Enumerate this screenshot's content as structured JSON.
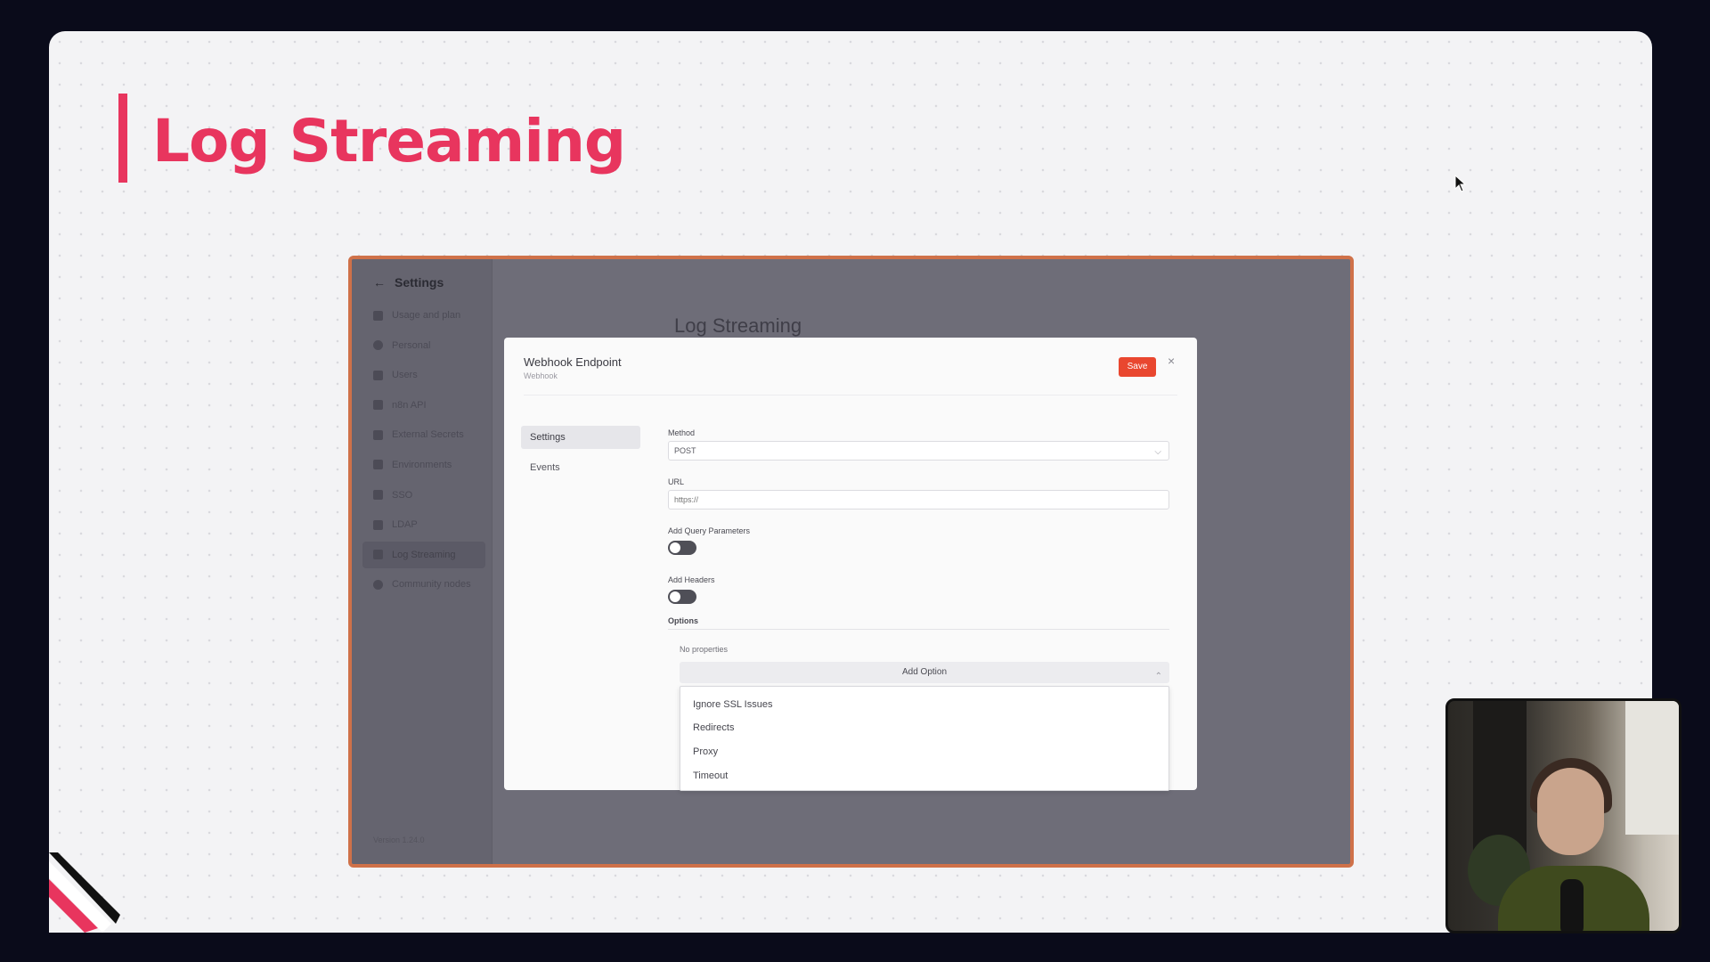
{
  "slide": {
    "title": "Log Streaming"
  },
  "app": {
    "sidebar": {
      "back_label": "Settings",
      "items": [
        {
          "label": "Usage and plan",
          "icon": "chart-icon"
        },
        {
          "label": "Personal",
          "icon": "person-icon"
        },
        {
          "label": "Users",
          "icon": "users-icon"
        },
        {
          "label": "n8n API",
          "icon": "plug-icon"
        },
        {
          "label": "External Secrets",
          "icon": "vault-icon"
        },
        {
          "label": "Environments",
          "icon": "branch-icon"
        },
        {
          "label": "SSO",
          "icon": "sso-icon"
        },
        {
          "label": "LDAP",
          "icon": "network-icon"
        },
        {
          "label": "Log Streaming",
          "icon": "stream-icon",
          "active": true
        },
        {
          "label": "Community nodes",
          "icon": "globe-icon"
        }
      ],
      "version": "Version 1.24.0"
    },
    "page_heading": "Log Streaming",
    "modal": {
      "title": "Webhook Endpoint",
      "subtitle": "Webhook",
      "save_label": "Save",
      "close_glyph": "×",
      "nav": [
        {
          "label": "Settings",
          "active": true
        },
        {
          "label": "Events",
          "active": false
        }
      ],
      "method": {
        "label": "Method",
        "value": "POST"
      },
      "url": {
        "label": "URL",
        "placeholder": "https://"
      },
      "query_params": {
        "label": "Add Query Parameters",
        "enabled": false
      },
      "headers": {
        "label": "Add Headers",
        "enabled": false
      },
      "options": {
        "label": "Options",
        "empty_text": "No properties",
        "add_label": "Add Option",
        "dropdown_items": [
          "Ignore SSL Issues",
          "Redirects",
          "Proxy",
          "Timeout"
        ]
      }
    }
  },
  "colors": {
    "accent": "#e8355e",
    "save": "#e9472f",
    "frame_border": "#cf7149"
  }
}
